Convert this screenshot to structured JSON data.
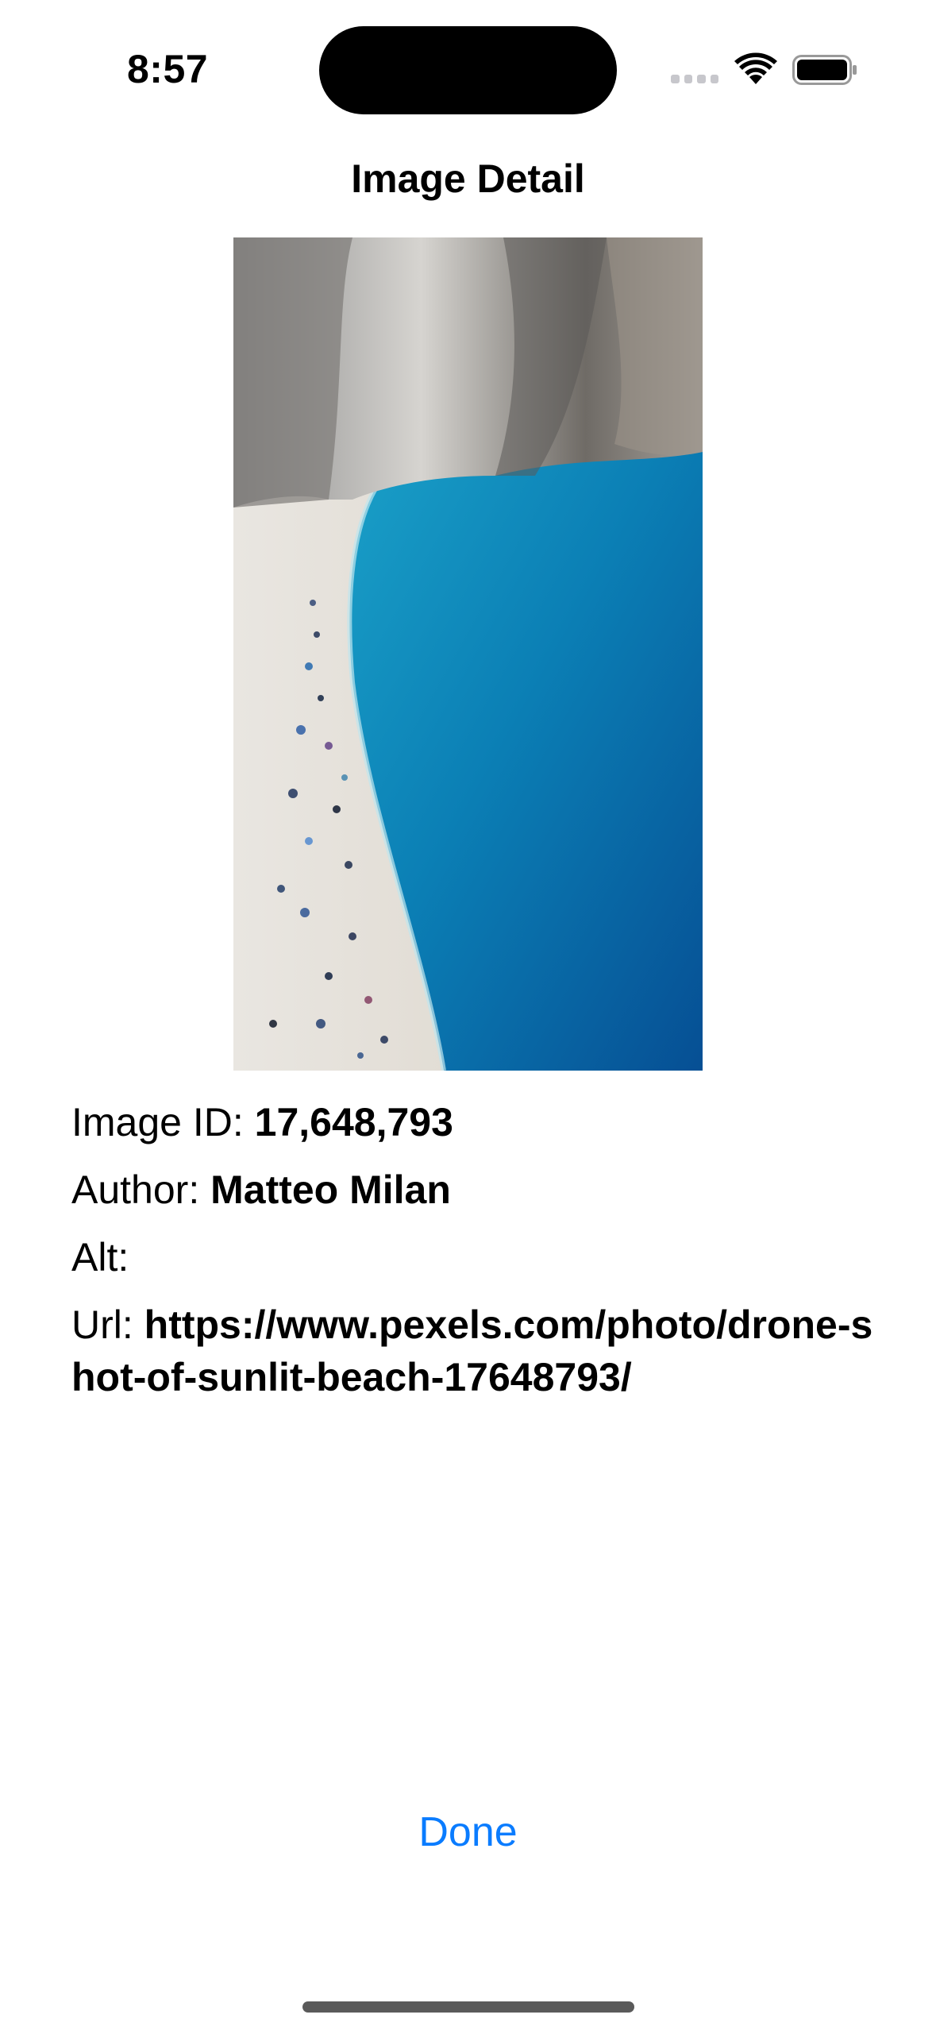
{
  "status_bar": {
    "time": "8:57",
    "icons": [
      "cellular-signal-icon",
      "wifi-icon",
      "battery-icon"
    ]
  },
  "nav": {
    "title": "Image Detail"
  },
  "photo": {
    "subject": "beach-photo"
  },
  "details": {
    "image_id_label": "Image ID: ",
    "image_id_value": "17,648,793",
    "author_label": "Author: ",
    "author_value": "Matteo Milan",
    "alt_label": "Alt:",
    "alt_value": "",
    "url_label": "Url: ",
    "url_value": "https://www.pexels.com/photo/drone-shot-of-sunlit-beach-17648793/"
  },
  "actions": {
    "done_label": "Done"
  },
  "colors": {
    "accent": "#0a7cff",
    "background": "#ffffff",
    "text": "#000000"
  }
}
